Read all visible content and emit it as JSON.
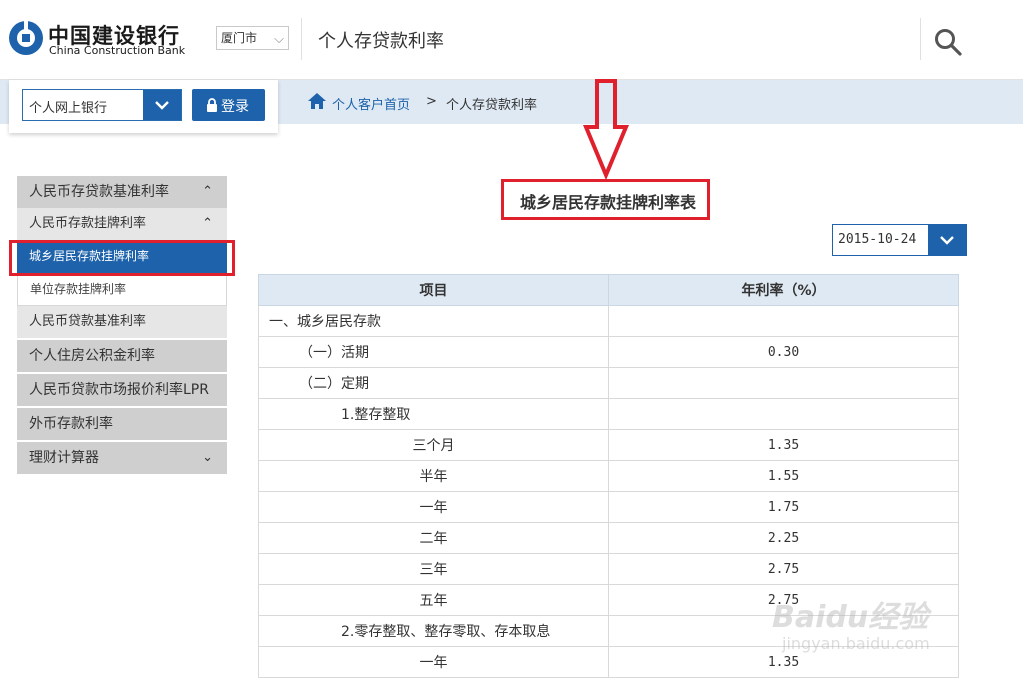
{
  "header": {
    "bank_name_cn": "中国建设银行",
    "bank_name_en": "China Construction Bank",
    "city": "厦门市",
    "page_title": "个人存贷款利率",
    "search_icon": "search-icon"
  },
  "login": {
    "bank_select": "个人网上银行",
    "login_label": "登录"
  },
  "breadcrumb": {
    "home": "个人客户首页",
    "separator": ">",
    "current": "个人存贷款利率"
  },
  "sidebar": {
    "group1": "人民币存贷款基准利率",
    "sub1": "人民币存款挂牌利率",
    "sub1_items": [
      "城乡居民存款挂牌利率",
      "单位存款挂牌利率"
    ],
    "sub2": "人民币贷款基准利率",
    "group2": "个人住房公积金利率",
    "group3": "人民币贷款市场报价利率LPR",
    "group4": "外币存款利率",
    "group5": "理财计算器"
  },
  "content": {
    "table_title": "城乡居民存款挂牌利率表",
    "date": "2015-10-24",
    "columns": [
      "项目",
      "年利率（%）"
    ],
    "rows": [
      {
        "item": "一、城乡居民存款",
        "rate": "",
        "indent": 0
      },
      {
        "item": "（一）活期",
        "rate": "0.30",
        "indent": 1
      },
      {
        "item": "（二）定期",
        "rate": "",
        "indent": 1
      },
      {
        "item": "1.整存整取",
        "rate": "",
        "indent": 2
      },
      {
        "item": "三个月",
        "rate": "1.35",
        "indent": 3
      },
      {
        "item": "半年",
        "rate": "1.55",
        "indent": 3
      },
      {
        "item": "一年",
        "rate": "1.75",
        "indent": 3
      },
      {
        "item": "二年",
        "rate": "2.25",
        "indent": 3
      },
      {
        "item": "三年",
        "rate": "2.75",
        "indent": 3
      },
      {
        "item": "五年",
        "rate": "2.75",
        "indent": 3
      },
      {
        "item": "2.零存整取、整存零取、存本取息",
        "rate": "",
        "indent": 2
      },
      {
        "item": "一年",
        "rate": "1.35",
        "indent": 3
      }
    ]
  },
  "watermark": {
    "brand": "Baidu经验",
    "url": "jingyan.baidu.com"
  },
  "colors": {
    "brand_blue": "#1d62aa",
    "highlight_red": "#e0212d",
    "band_blue": "#dfe9f4"
  }
}
